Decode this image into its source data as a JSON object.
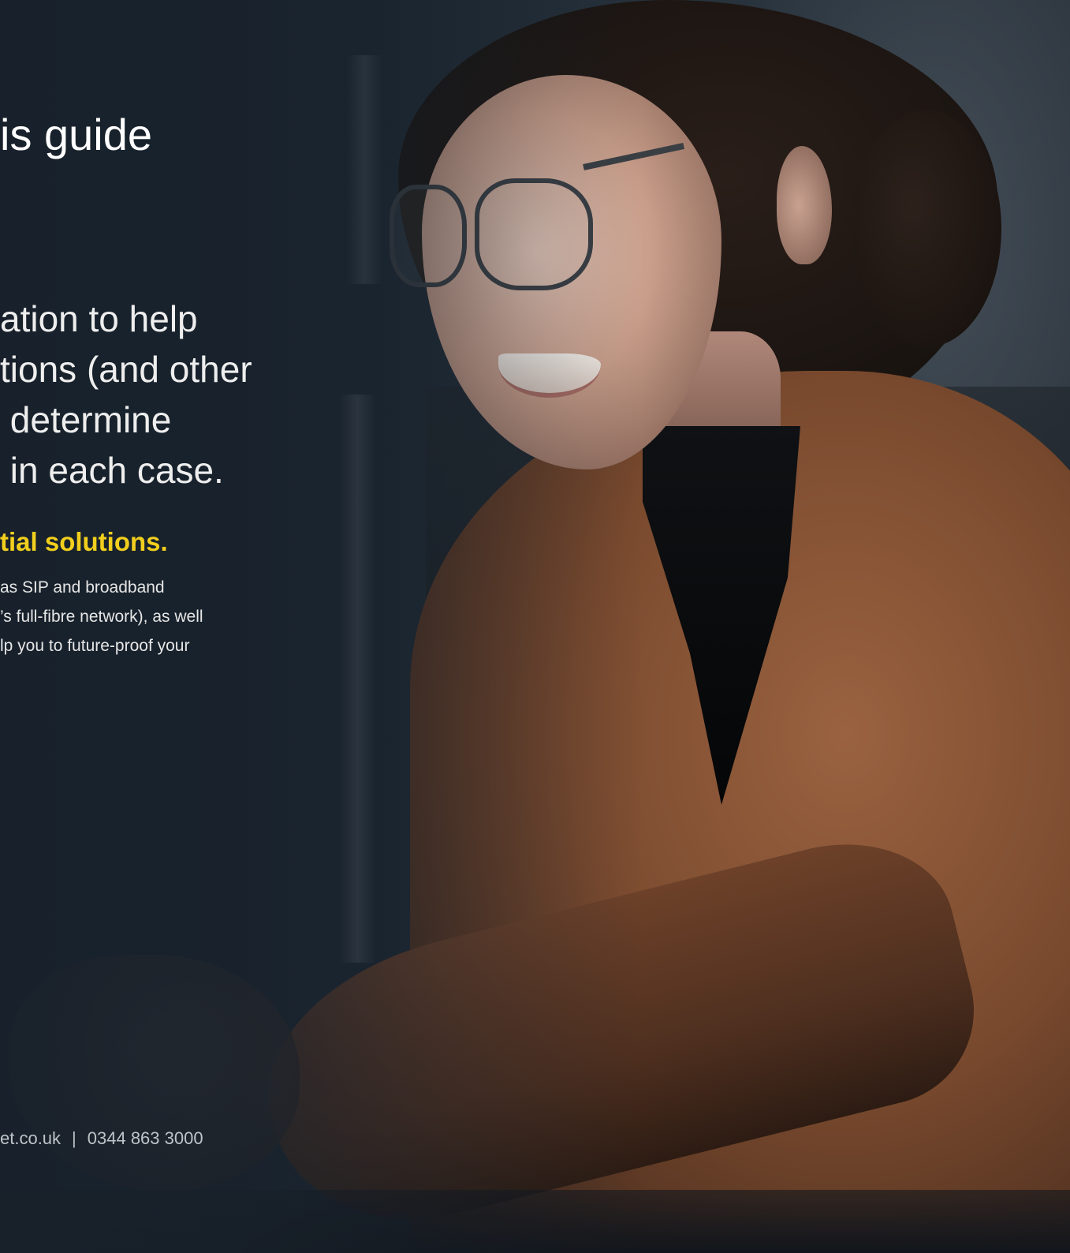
{
  "heading": "is guide",
  "intro": {
    "lines": [
      "ation to help",
      "tions (and other",
      " determine",
      " in each case."
    ]
  },
  "highlight": "tial solutions.",
  "body": {
    "lines": [
      "as SIP and broadband",
      "’s full-fibre network), as well",
      "lp you to future-proof your"
    ]
  },
  "footer": {
    "website": "et.co.uk",
    "separator": "|",
    "phone": "0344 863 3000"
  },
  "colors": {
    "background": "#1b2530",
    "highlight": "#f2cf1d",
    "text": "#eeeeee"
  }
}
